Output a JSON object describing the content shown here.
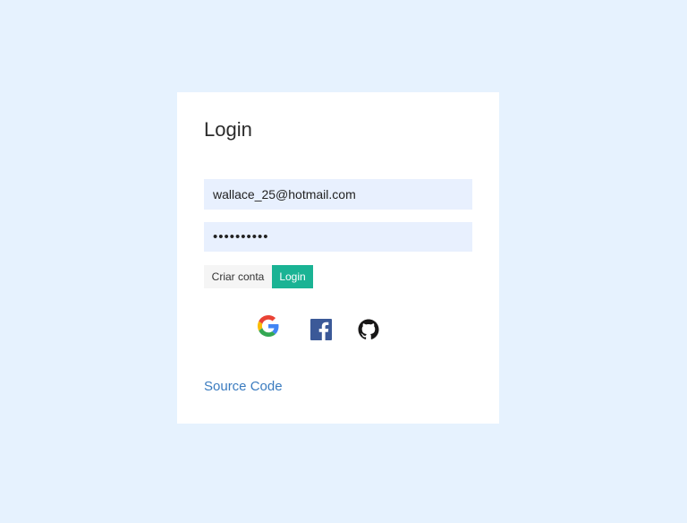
{
  "login": {
    "title": "Login",
    "email_value": "wallace_25@hotmail.com",
    "password_value": "••••••••••",
    "create_account_label": "Criar conta",
    "login_button_label": "Login",
    "social": [
      "google-icon",
      "facebook-icon",
      "github-icon"
    ],
    "source_code_label": "Source Code"
  },
  "colors": {
    "background": "#e6f2fe",
    "card": "#ffffff",
    "input_bg": "#e8f0fe",
    "login_button": "#1ab394",
    "link": "#3a7bbf",
    "facebook": "#3b5998"
  }
}
